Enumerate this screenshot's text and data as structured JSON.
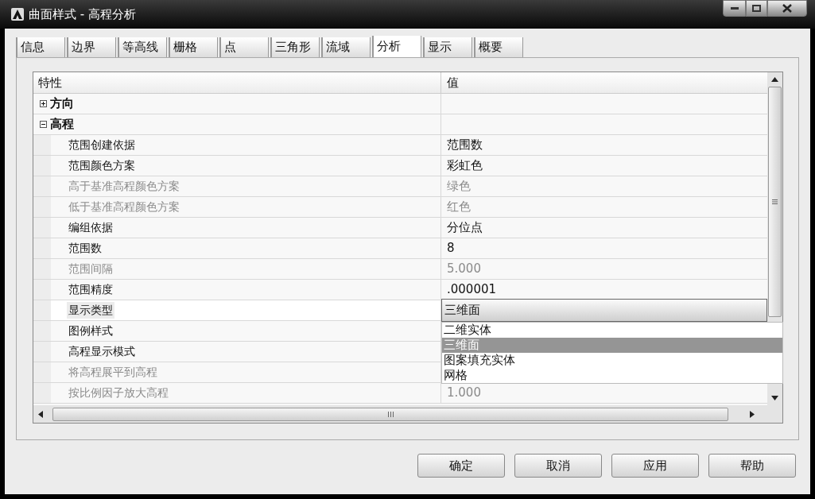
{
  "window": {
    "title": "曲面样式 - 高程分析"
  },
  "tabs": [
    {
      "label": "信息",
      "selected": false
    },
    {
      "label": "边界",
      "selected": false
    },
    {
      "label": "等高线",
      "selected": false
    },
    {
      "label": "栅格",
      "selected": false
    },
    {
      "label": "点",
      "selected": false
    },
    {
      "label": "三角形",
      "selected": false
    },
    {
      "label": "流域",
      "selected": false
    },
    {
      "label": "分析",
      "selected": true
    },
    {
      "label": "显示",
      "selected": false
    },
    {
      "label": "概要",
      "selected": false
    }
  ],
  "grid": {
    "columns": [
      "特性",
      "值"
    ],
    "rows": [
      {
        "label": "方向",
        "expanded": false
      },
      {
        "label": "高程",
        "expanded": true,
        "children": [
          {
            "label": "范围创建依据",
            "value": "范围数",
            "disabled": false,
            "selected": false
          },
          {
            "label": "范围颜色方案",
            "value": "彩虹色",
            "disabled": false,
            "selected": false
          },
          {
            "label": "高于基准高程颜色方案",
            "value": "绿色",
            "disabled": true,
            "selected": false
          },
          {
            "label": "低于基准高程颜色方案",
            "value": "红色",
            "disabled": true,
            "selected": false
          },
          {
            "label": "编组依据",
            "value": "分位点",
            "disabled": false,
            "selected": false
          },
          {
            "label": "范围数",
            "value": "8",
            "disabled": false,
            "selected": false
          },
          {
            "label": "范围间隔",
            "value": "5.000",
            "disabled": true,
            "selected": false
          },
          {
            "label": "范围精度",
            "value": ".000001",
            "disabled": false,
            "selected": false
          },
          {
            "label": "显示类型",
            "disabled": false,
            "selected": true,
            "editor": {
              "value": "三维面",
              "options": [
                {
                  "label": "二维实体",
                  "selected": false
                },
                {
                  "label": "三维面",
                  "selected": true
                },
                {
                  "label": "图案填充实体",
                  "selected": false
                },
                {
                  "label": "网格",
                  "selected": false
                }
              ]
            }
          },
          {
            "label": "图例样式",
            "disabled": false,
            "selected": false
          },
          {
            "label": "高程显示模式",
            "disabled": false,
            "selected": false
          },
          {
            "label": "将高程展平到高程",
            "disabled": true,
            "selected": false
          },
          {
            "label": "按比例因子放大高程",
            "value": "1.000",
            "disabled": true,
            "selected": false
          }
        ]
      }
    ]
  },
  "buttons": [
    "确定",
    "取消",
    "应用",
    "帮助"
  ]
}
